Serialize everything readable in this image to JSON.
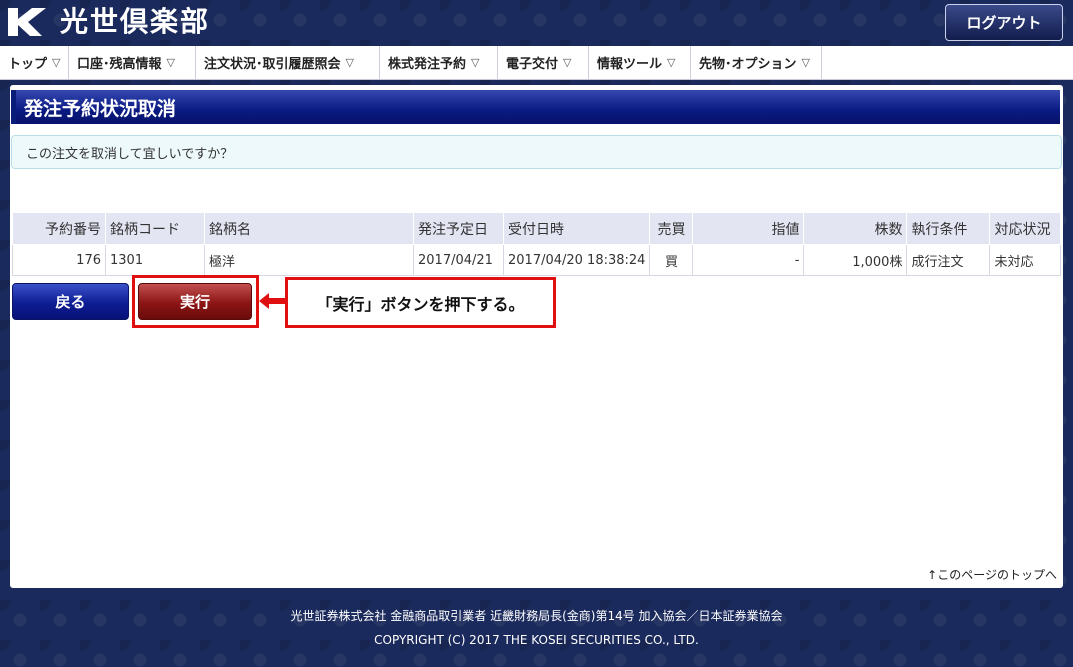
{
  "header": {
    "logo_text": "光世倶楽部",
    "logout_label": "ログアウト"
  },
  "nav": {
    "items": [
      {
        "label": "トップ"
      },
      {
        "label": "口座･残高情報"
      },
      {
        "label": "注文状況･取引履歴照会"
      },
      {
        "label": "株式発注予約"
      },
      {
        "label": "電子交付"
      },
      {
        "label": "情報ツール"
      },
      {
        "label": "先物･オプション"
      }
    ],
    "chevron": "▽"
  },
  "page": {
    "title": "発注予約状況取消",
    "confirm_message": "この注文を取消して宜しいですか？"
  },
  "table": {
    "headers": [
      "予約番号",
      "銘柄コード",
      "銘柄名",
      "発注予定日",
      "受付日時",
      "売買",
      "指値",
      "株数",
      "執行条件",
      "対応状況"
    ],
    "rows": [
      [
        "176",
        "1301",
        "極洋",
        "2017/04/21",
        "2017/04/20 18:38:24",
        "買",
        "-",
        "1,000株",
        "成行注文",
        "未対応"
      ]
    ]
  },
  "buttons": {
    "back_label": "戻る",
    "execute_label": "実行"
  },
  "annotation": {
    "callout_text": "「実行」ボタンを押下する。",
    "highlight_color": "#e01010"
  },
  "page_top_link": "↑このページのトップへ",
  "footer": {
    "line1": "光世証券株式会社  金融商品取引業者  近畿財務局長(金商)第14号  加入協会／日本証券業協会",
    "line2": "COPYRIGHT (C) 2017 THE KOSEI SECURITIES CO., LTD."
  },
  "colors": {
    "background": "#1b2a5c",
    "title_bar": "#0a1a82",
    "back_button": "#0d1d93",
    "execute_button": "#8c1414",
    "table_header": "#e3e5f3"
  }
}
